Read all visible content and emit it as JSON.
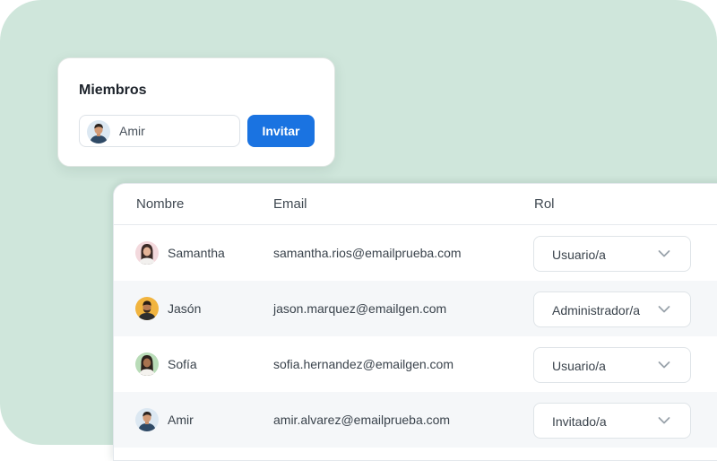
{
  "members_card": {
    "title": "Miembros",
    "invite_input_value": "Amir",
    "invite_button_label": "Invitar"
  },
  "table": {
    "headers": {
      "name": "Nombre",
      "email": "Email",
      "role": "Rol"
    },
    "rows": [
      {
        "name": "Samantha",
        "email": "samantha.rios@emailprueba.com",
        "role": "Usuario/a",
        "avatar_icon": "woman-avatar-icon"
      },
      {
        "name": "Jasón",
        "email": "jason.marquez@emailgen.com",
        "role": "Administrador/a",
        "avatar_icon": "man-avatar-icon"
      },
      {
        "name": "Sofía",
        "email": "sofia.hernandez@emailgen.com",
        "role": "Usuario/a",
        "avatar_icon": "woman-avatar-icon"
      },
      {
        "name": "Amir",
        "email": "amir.alvarez@emailprueba.com",
        "role": "Invitado/a",
        "avatar_icon": "man-avatar-icon"
      }
    ]
  },
  "colors": {
    "background": "#cfe6db",
    "accent": "#1a73e1"
  }
}
